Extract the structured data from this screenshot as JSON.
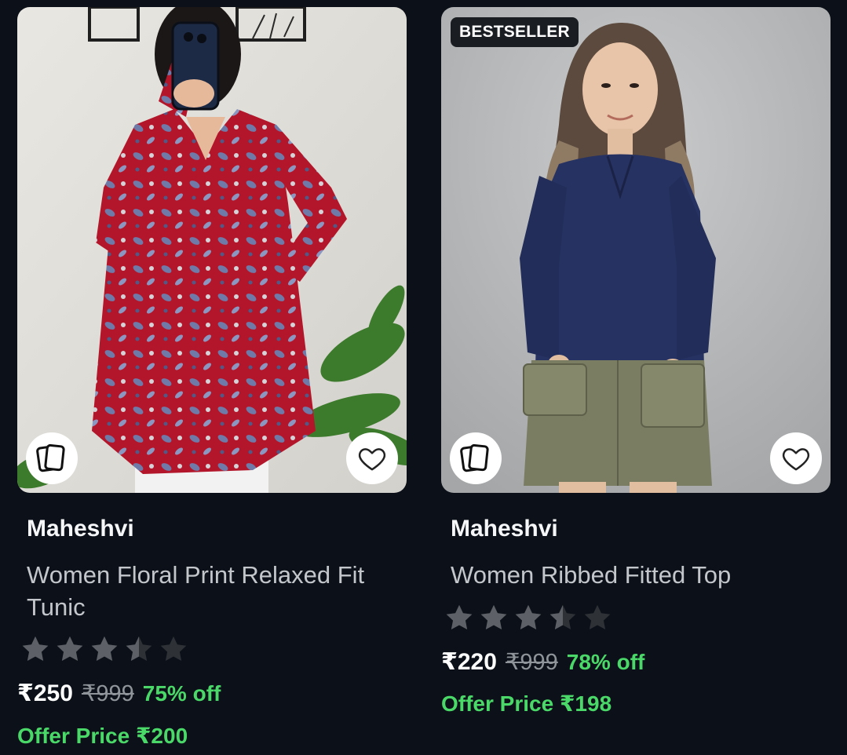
{
  "colors": {
    "background": "#0c1018",
    "discount_green": "#4ad869",
    "badge_bg": "#1a1d22",
    "star_filled": "#5d6167",
    "star_empty": "#2e3237"
  },
  "icons": {
    "similar": "stacked-cards-icon",
    "wishlist": "heart-outline-icon",
    "rating": "star-icon"
  },
  "products": [
    {
      "badge": "",
      "brand": "Maheshvi",
      "title": "Women Floral Print Relaxed Fit Tunic",
      "rating": 3.5,
      "rating_max": 5,
      "price": "₹250",
      "mrp": "₹999",
      "discount": "75% off",
      "offer_price": "Offer Price ₹200"
    },
    {
      "badge": "BESTSELLER",
      "brand": "Maheshvi",
      "title": "Women Ribbed Fitted Top",
      "rating": 3.5,
      "rating_max": 5,
      "price": "₹220",
      "mrp": "₹999",
      "discount": "78% off",
      "offer_price": "Offer Price ₹198"
    }
  ]
}
